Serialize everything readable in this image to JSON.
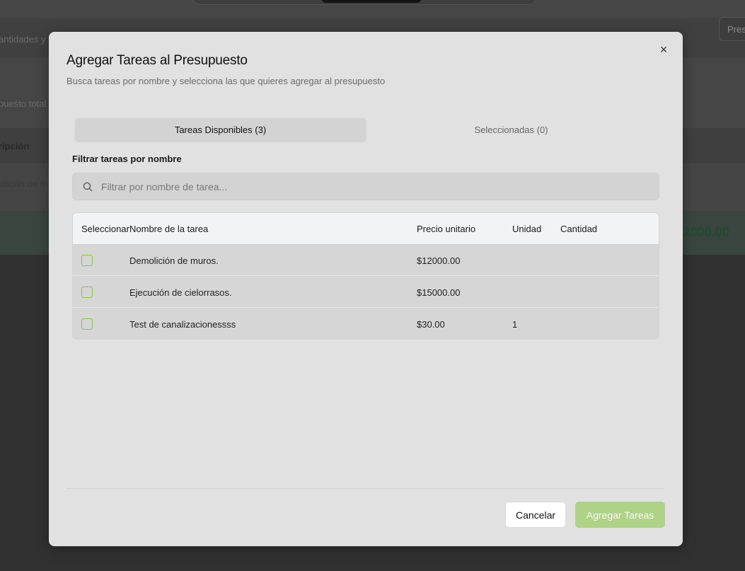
{
  "background": {
    "top_band_text": "antidades y",
    "budget_button": "Pres",
    "total_label": "puesto total",
    "description_header": "ripción",
    "row_text": "olición de m",
    "total_amount": "2000.00"
  },
  "modal": {
    "title": "Agregar Tareas al Presupuesto",
    "subtitle": "Busca tareas por nombre y selecciona las que quieres agregar al presupuesto",
    "close_glyph": "×",
    "tabs": [
      {
        "label": "Tareas Disponibles (3)",
        "active": true
      },
      {
        "label": "Seleccionadas (0)",
        "active": false
      }
    ],
    "filter": {
      "label": "Filtrar tareas por nombre",
      "placeholder": "Filtrar por nombre de tarea...",
      "value": "",
      "icon": "search-icon"
    },
    "table": {
      "headers": {
        "select": "Seleccionar",
        "name": "Nombre de la tarea",
        "price": "Precio unitario",
        "unit": "Unidad",
        "quantity": "Cantidad"
      },
      "rows": [
        {
          "checked": false,
          "name": "Demolición de muros.",
          "price": "$12000.00",
          "unit": "",
          "quantity": ""
        },
        {
          "checked": false,
          "name": "Ejecución de cielorrasos.",
          "price": "$15000.00",
          "unit": "",
          "quantity": ""
        },
        {
          "checked": false,
          "name": "Test de canalizacionessss",
          "price": "$30.00",
          "unit": "1",
          "quantity": ""
        }
      ]
    },
    "buttons": {
      "cancel": "Cancelar",
      "add": "Agregar Tareas"
    }
  },
  "colors": {
    "accent_green": "#8bc34a",
    "add_button_disabled": "#aed286",
    "overlay": "#313131"
  }
}
